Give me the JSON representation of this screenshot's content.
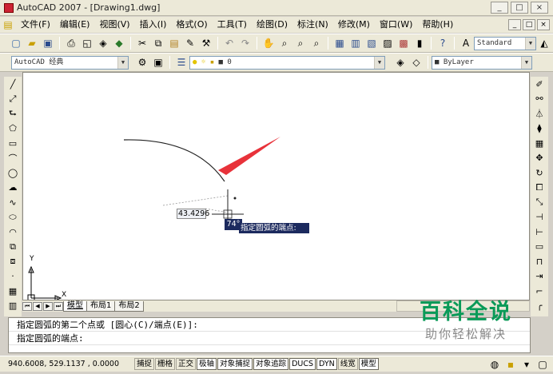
{
  "window": {
    "title": "AutoCAD 2007 - [Drawing1.dwg]",
    "controls": [
      "_",
      "□",
      "×"
    ],
    "mdi_controls": [
      "_",
      "□",
      "×"
    ]
  },
  "menubar": {
    "items": [
      "文件(F)",
      "编辑(E)",
      "视图(V)",
      "插入(I)",
      "格式(O)",
      "工具(T)",
      "绘图(D)",
      "标注(N)",
      "修改(M)",
      "窗口(W)",
      "帮助(H)"
    ]
  },
  "toolbar2": {
    "text_style": "Standard"
  },
  "toolbar3": {
    "workspace": "AutoCAD 经典",
    "layer": "0",
    "color": "ByLayer"
  },
  "drawing": {
    "dynamic_input_value": "43.4296",
    "angle_value": "74°",
    "tooltip_prompt": "指定圆弧的端点:",
    "ucs_x": "X",
    "ucs_y": "Y"
  },
  "layout_tabs": {
    "nav": [
      "⏮",
      "◀",
      "▶",
      "⏭"
    ],
    "tabs": [
      "模型",
      "布局1",
      "布局2"
    ]
  },
  "command_window": {
    "lines": [
      "指定圆弧的第二个点或 [圆心(C)/端点(E)]:",
      "指定圆弧的端点:"
    ]
  },
  "statusbar": {
    "coordinates": "940.6008,  529.1137 , 0.0000",
    "buttons": [
      "捕捉",
      "栅格",
      "正交",
      "极轴",
      "对象捕捉",
      "对象追踪",
      "DUCS",
      "DYN",
      "线宽",
      "模型"
    ],
    "active": [
      false,
      false,
      false,
      true,
      true,
      true,
      true,
      true,
      false,
      true
    ]
  },
  "watermark": {
    "title": "百科全说",
    "subtitle": "助你轻松解决"
  },
  "colors": {
    "arrow": "#e8323a",
    "watermark_green": "#0a9a58",
    "tooltip_bg": "#1c2a5e"
  }
}
